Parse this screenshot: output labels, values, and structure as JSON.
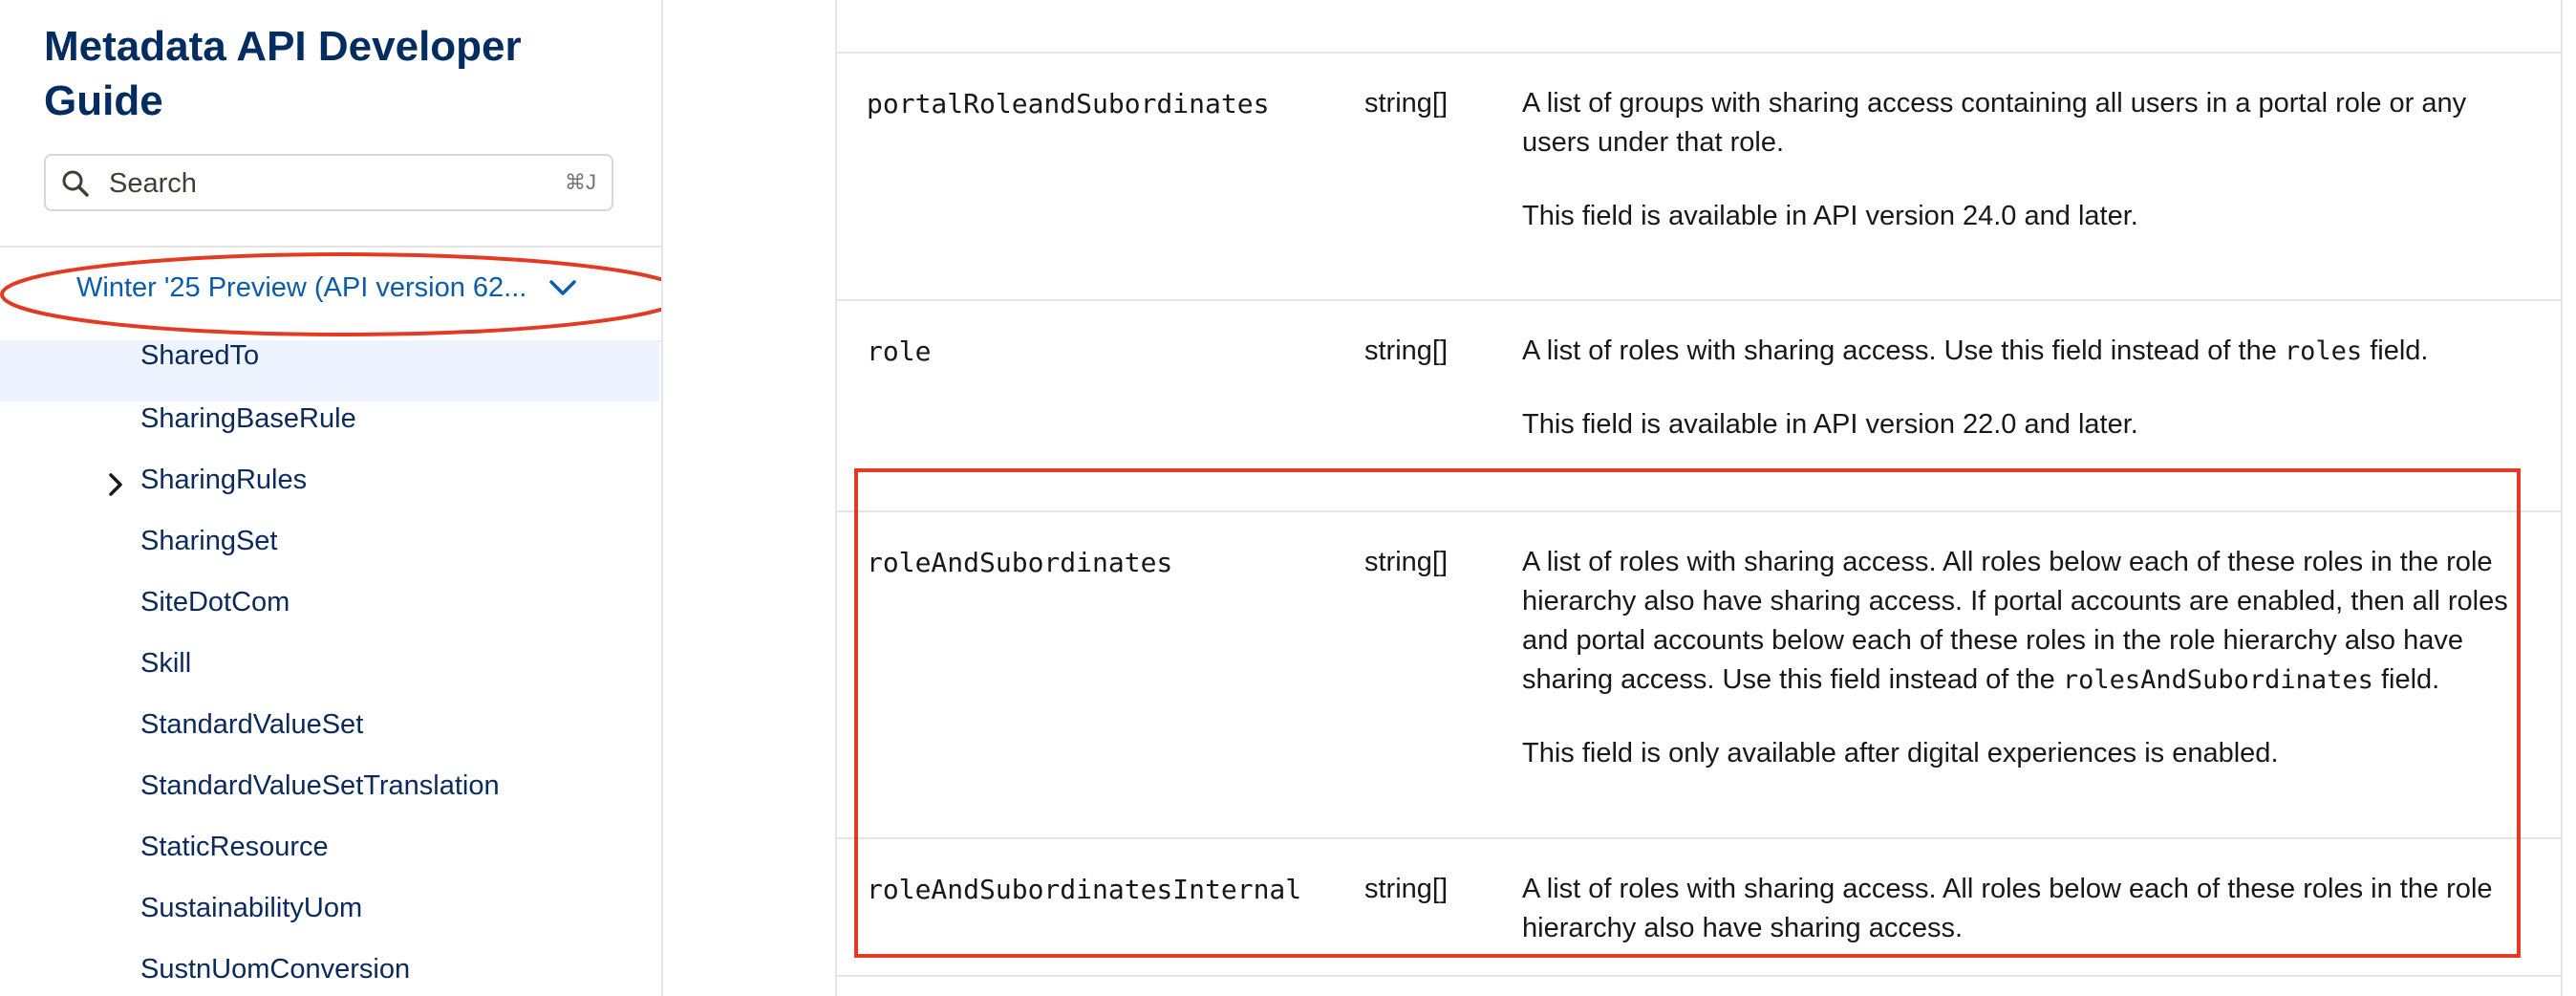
{
  "sidebar": {
    "title": "Metadata API Developer Guide",
    "search": {
      "placeholder": "Search",
      "shortcut": "⌘J"
    },
    "version_label": "Winter '25 Preview (API version 62...",
    "items": [
      {
        "label": "SharedTo",
        "selected": true
      },
      {
        "label": "SharingBaseRule"
      },
      {
        "label": "SharingRules",
        "expandable": true
      },
      {
        "label": "SharingSet"
      },
      {
        "label": "SiteDotCom"
      },
      {
        "label": "Skill"
      },
      {
        "label": "StandardValueSet"
      },
      {
        "label": "StandardValueSetTranslation"
      },
      {
        "label": "StaticResource"
      },
      {
        "label": "SustainabilityUom"
      },
      {
        "label": "SustnUomConversion"
      }
    ]
  },
  "fields": [
    {
      "name": "portalRoleandSubordinates",
      "type": "string[]",
      "description": "A list of groups with sharing access containing all users in a portal role or any users under that role.",
      "note": "This field is available in API version 24.0 and later."
    },
    {
      "name": "role",
      "type": "string[]",
      "description_before": "A list of roles with sharing access. Use this field instead of the ",
      "description_code": "roles",
      "description_after": " field.",
      "note": "This field is available in API version 22.0 and later."
    },
    {
      "name": "roleAndSubordinates",
      "type": "string[]",
      "description_before": "A list of roles with sharing access. All roles below each of these roles in the role hierarchy also have sharing access. If portal accounts are enabled, then all roles and portal accounts below each of these roles in the role hierarchy also have sharing access. Use this field instead of the ",
      "description_code": "rolesAndSubordinates",
      "description_after": " field.",
      "note": "This field is only available after digital experiences is enabled."
    },
    {
      "name": "roleAndSubordinatesInternal",
      "type": "string[]",
      "description": "A list of roles with sharing access. All roles below each of these roles in the role hierarchy also have sharing access."
    }
  ],
  "colors": {
    "annotation": "#e33b23",
    "title": "#032d60",
    "link": "#0b5cab",
    "selected_bg": "#eef4ff"
  }
}
